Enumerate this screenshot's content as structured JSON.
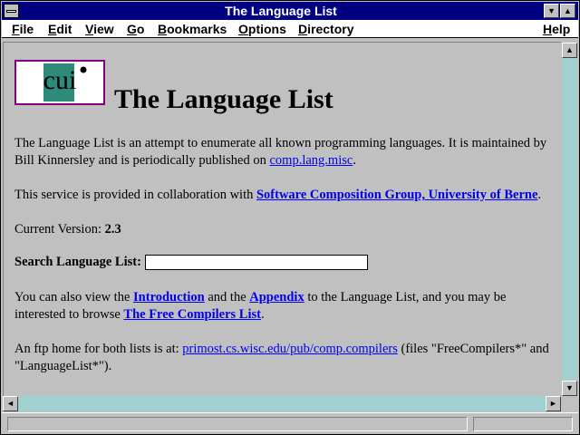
{
  "window": {
    "title": "The Language List",
    "sys_icon": "system-menu-icon",
    "min_icon": "▼",
    "max_icon": "▲"
  },
  "menu": {
    "file": {
      "u": "F",
      "rest": "ile"
    },
    "edit": {
      "u": "E",
      "rest": "dit"
    },
    "view": {
      "u": "V",
      "rest": "iew"
    },
    "go": {
      "u": "G",
      "rest": "o"
    },
    "bookmarks": {
      "u": "B",
      "rest": "ookmarks"
    },
    "options": {
      "u": "O",
      "rest": "ptions"
    },
    "directory": {
      "u": "D",
      "rest": "irectory"
    },
    "help": {
      "u": "H",
      "rest": "elp"
    }
  },
  "page": {
    "heading": "The Language List",
    "logo_alt": "cui",
    "intro_1": "The Language List is an attempt to enumerate all known programming languages. It is maintained by Bill Kinnersley and is periodically published on ",
    "intro_link": "comp.lang.misc",
    "intro_end": ".",
    "collab_1": "This service is provided in collaboration with ",
    "collab_link": "Software Composition Group, University of Berne",
    "collab_end": ".",
    "version_label": "Current Version: ",
    "version_value": "2.3",
    "search_label": "Search Language List:",
    "search_value": "",
    "also_1": "You can also view the ",
    "also_link1": "Introduction",
    "also_2": " and the ",
    "also_link2": "Appendix",
    "also_3": " to the Language List, and you may be interested to browse ",
    "also_link3": "The Free Compilers List",
    "also_end": ".",
    "ftp_1": "An ftp home for both lists is at: ",
    "ftp_link": "primost.cs.wisc.edu/pub/comp.compilers",
    "ftp_2": " (files \"FreeCompilers*\" and \"LanguageList*\")."
  },
  "scrollbars": {
    "up": "▲",
    "down": "▼",
    "left": "◄",
    "right": "►"
  },
  "colors": {
    "titlebar": "#000080",
    "link": "#0000ee",
    "logo_border": "#800080",
    "logo_teal": "#2e8b7a"
  }
}
